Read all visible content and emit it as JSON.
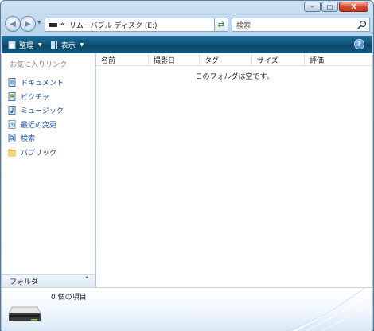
{
  "window": {
    "caption": {
      "minimize_glyph": "–",
      "maximize_glyph": "□",
      "close_glyph": "X"
    }
  },
  "address": {
    "chevrons": "«",
    "location": "リムーバブル ディスク (E:)",
    "dropdown_glyph": "▼"
  },
  "search": {
    "placeholder": "検索",
    "icon": "magnifier-icon"
  },
  "toolbar": {
    "organize_label": "整理",
    "views_label": "表示",
    "help_glyph": "?"
  },
  "nav_pane": {
    "favorites_heading": "お気に入りリンク",
    "items": [
      {
        "label": "ドキュメント",
        "icon": "documents-icon"
      },
      {
        "label": "ピクチャ",
        "icon": "pictures-icon"
      },
      {
        "label": "ミュージック",
        "icon": "music-icon"
      },
      {
        "label": "最近の変更",
        "icon": "recent-changes-icon"
      },
      {
        "label": "検索",
        "icon": "search-folder-icon"
      },
      {
        "label": "パブリック",
        "icon": "public-folder-icon"
      }
    ],
    "folders_label": "フォルダ",
    "folders_chevron": "^"
  },
  "content": {
    "columns": [
      "名前",
      "撮影日",
      "タグ",
      "サイズ",
      "評価"
    ],
    "empty_message": "このフォルダは空です。"
  },
  "details": {
    "item_count": "0 個の項目",
    "icon": "removable-drive-icon"
  },
  "colors": {
    "toolbar": "#0f5176",
    "link": "#1c4fa0",
    "close_button": "#c23920"
  }
}
